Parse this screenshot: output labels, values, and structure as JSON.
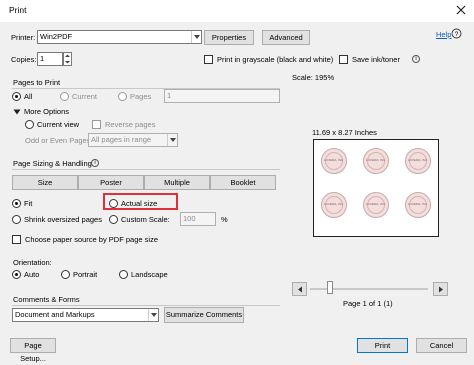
{
  "window": {
    "title": "Print"
  },
  "printer": {
    "label": "Printer:",
    "value": "Win2PDF",
    "properties_label": "Properties",
    "advanced_label": "Advanced",
    "help_label": "Help"
  },
  "copies": {
    "label": "Copies:",
    "value": "1",
    "grayscale_label": "Print in grayscale (black and white)",
    "save_ink_label": "Save ink/toner"
  },
  "pages_to_print": {
    "header": "Pages to Print",
    "all_label": "All",
    "current_label": "Current",
    "pages_label": "Pages",
    "pages_value": "1",
    "more_options_label": "More Options",
    "current_view_label": "Current view",
    "reverse_pages_label": "Reverse pages",
    "odd_even_label": "Odd or Even Pages:",
    "odd_even_value": "All pages in range"
  },
  "sizing": {
    "header": "Page Sizing & Handling",
    "tabs": [
      "Size",
      "Poster",
      "Multiple",
      "Booklet"
    ],
    "fit_label": "Fit",
    "actual_size_label": "Actual size",
    "shrink_label": "Shrink oversized pages",
    "custom_scale_label": "Custom Scale:",
    "custom_scale_value": "100",
    "percent": "%",
    "paper_source_label": "Choose paper source by PDF page size",
    "highlight_color": "#e0303a"
  },
  "orientation": {
    "header": "Orientation:",
    "options": [
      "Auto",
      "Portrait",
      "Landscape"
    ],
    "selected": "Auto"
  },
  "comments": {
    "header": "Comments & Forms",
    "value": "Document and Markups",
    "summarize_label": "Summarize Comments"
  },
  "preview": {
    "scale": "Scale: 195%",
    "size": "11.69 x 8.27 Inches",
    "page_indicator": "Page 1 of 1 (1)",
    "labels": [
      "LOVEMA, INC.",
      "LOVEMA, INC.",
      "LOVEMA, INC.",
      "LOVEMA, INC.",
      "LOVEMA, INC.",
      "LOVEMA, INC."
    ]
  },
  "footer": {
    "page_setup_label": "Page Setup...",
    "print_label": "Print",
    "cancel_label": "Cancel"
  }
}
